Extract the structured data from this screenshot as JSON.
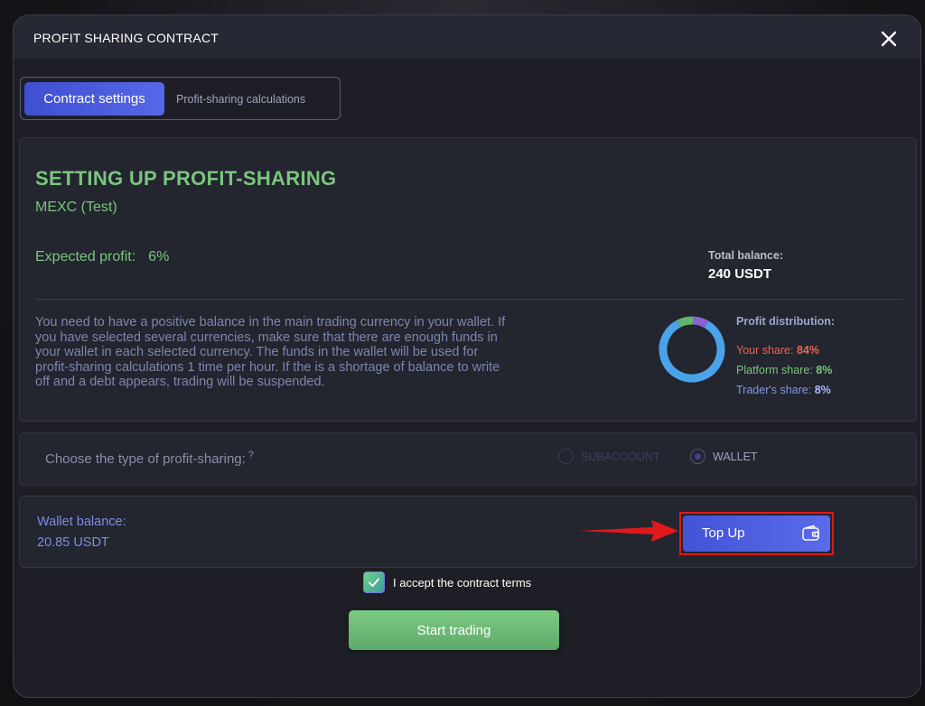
{
  "modal": {
    "title": "PROFIT SHARING CONTRACT"
  },
  "tabs": [
    {
      "label": "Contract settings",
      "active": true
    },
    {
      "label": "Profit-sharing calculations",
      "active": false
    }
  ],
  "setup": {
    "title": "SETTING UP PROFIT-SHARING",
    "exchange": "MEXC (Test)",
    "expected_profit_label": "Expected profit:",
    "expected_profit_value": "6%",
    "total_balance_label": "Total balance:",
    "total_balance_value": "240 USDT",
    "description": "You need to have a positive balance in the main trading currency in your wallet. If you have selected several currencies, make sure that there are enough funds in your wallet in each selected currency. The funds in the wallet will be used for profit-sharing calculations 1 time per hour. If the is a shortage of balance to write off and a debt appears, trading will be suspended."
  },
  "profit_distribution": {
    "title": "Profit distribution:",
    "your_share_label": "Your share:",
    "your_share_value": "84%",
    "platform_share_label": "Platform share:",
    "platform_share_value": "8%",
    "trader_share_label": "Trader's share:",
    "trader_share_value": "8%",
    "shares": [
      84,
      8,
      8
    ],
    "colors": {
      "your_share": "#4aa3e8",
      "platform_share": "#63b56b",
      "trader_share": "#8a63d2"
    }
  },
  "profit_type": {
    "label": "Choose the type of profit-sharing:",
    "help": "?",
    "options": [
      {
        "label": "SUBACCOUNT",
        "selected": false,
        "disabled": true
      },
      {
        "label": "WALLET",
        "selected": true,
        "disabled": false
      }
    ]
  },
  "wallet": {
    "balance_label": "Wallet balance:",
    "balance_value": "20.85 USDT",
    "topup_label": "Top Up"
  },
  "terms": {
    "label": "I accept the contract terms",
    "checked": true
  },
  "actions": {
    "start_label": "Start trading"
  },
  "colors": {
    "accent_blue": "#4a5ae0",
    "accent_green": "#7bc57e",
    "highlight_red": "#e01a1a"
  },
  "icons": {
    "close": "close-icon",
    "wallet": "wallet-icon",
    "check": "check-icon",
    "arrow": "arrow-right-icon"
  }
}
